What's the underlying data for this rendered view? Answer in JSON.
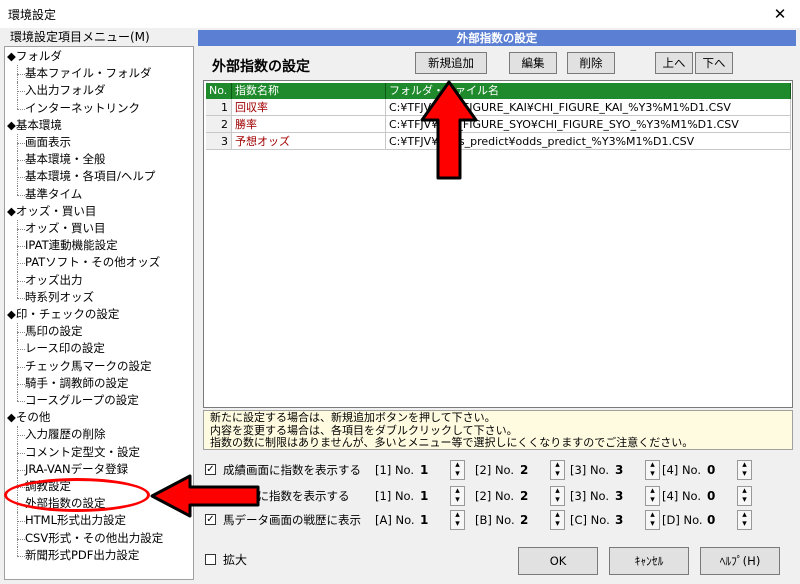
{
  "window": {
    "title": "環境設定",
    "close_glyph": "✕"
  },
  "menu": {
    "header": "環境設定項目メニュー(M)",
    "items": [
      {
        "type": "cat",
        "label": "◆フォルダ"
      },
      {
        "type": "sub",
        "label": "基本ファイル・フォルダ"
      },
      {
        "type": "sub",
        "label": "入出力フォルダ"
      },
      {
        "type": "sub",
        "label": "インターネットリンク"
      },
      {
        "type": "cat",
        "label": "◆基本環境"
      },
      {
        "type": "sub",
        "label": "画面表示"
      },
      {
        "type": "sub",
        "label": "基本環境・全般"
      },
      {
        "type": "sub",
        "label": "基本環境・各項目/ヘルプ"
      },
      {
        "type": "sub",
        "label": "基準タイム"
      },
      {
        "type": "cat",
        "label": "◆オッズ・買い目"
      },
      {
        "type": "sub",
        "label": "オッズ・買い目"
      },
      {
        "type": "sub",
        "label": "IPAT連動機能設定"
      },
      {
        "type": "sub",
        "label": "PATソフト・その他オッズ"
      },
      {
        "type": "sub",
        "label": "オッズ出力"
      },
      {
        "type": "sub",
        "label": "時系列オッズ"
      },
      {
        "type": "cat",
        "label": "◆印・チェックの設定"
      },
      {
        "type": "sub",
        "label": "馬印の設定"
      },
      {
        "type": "sub",
        "label": "レース印の設定"
      },
      {
        "type": "sub",
        "label": "チェック馬マークの設定"
      },
      {
        "type": "sub",
        "label": "騎手・調教師の設定"
      },
      {
        "type": "sub",
        "label": "コースグループの設定"
      },
      {
        "type": "cat",
        "label": "◆その他"
      },
      {
        "type": "sub",
        "label": "入力履歴の削除"
      },
      {
        "type": "sub",
        "label": "コメント定型文・設定"
      },
      {
        "type": "sub",
        "label": "JRA-VANデータ登録"
      },
      {
        "type": "sub",
        "label": "調教設定"
      },
      {
        "type": "sub",
        "label": "外部指数の設定"
      },
      {
        "type": "sub",
        "label": "HTML形式出力設定"
      },
      {
        "type": "sub",
        "label": "CSV形式・その他出力設定"
      },
      {
        "type": "sub",
        "label": "新聞形式PDF出力設定"
      }
    ]
  },
  "panel": {
    "header": "外部指数の設定",
    "title": "外部指数の設定",
    "buttons": {
      "add": "新規追加",
      "edit": "編集",
      "delete": "削除",
      "up": "上へ",
      "down": "下へ"
    },
    "grid": {
      "headers": [
        "No.",
        "指数名称",
        "フォルダ・ファイル名"
      ],
      "rows": [
        {
          "no": "1",
          "name": "回収率",
          "path": "C:¥TFJV¥CHI_FIGURE_KAI¥CHI_FIGURE_KAI_%Y3%M1%D1.CSV"
        },
        {
          "no": "2",
          "name": "勝率",
          "path": "C:¥TFJV¥CHI_FIGURE_SYO¥CHI_FIGURE_SYO_%Y3%M1%D1.CSV"
        },
        {
          "no": "3",
          "name": "予想オッズ",
          "path": "C:¥TFJV¥odds_predict¥odds_predict_%Y3%M1%D1.CSV"
        }
      ]
    },
    "info_lines": [
      "新たに設定する場合は、新規追加ボタンを押して下さい。",
      "内容を変更する場合は、各項目をダブルクリックして下さい。",
      "指数の数に制限はありませんが、多いとメニュー等で選択しにくくなりますのでご注意ください。"
    ],
    "options": [
      {
        "checked": true,
        "label": "成績画面に指数を表示する",
        "slots": [
          [
            "[1] No.",
            "1"
          ],
          [
            "[2] No.",
            "2"
          ],
          [
            "[3] No.",
            "3"
          ],
          [
            "[4] No.",
            "0"
          ]
        ]
      },
      {
        "checked": true,
        "label": "出馬表に指数を表示する",
        "slots": [
          [
            "[1] No.",
            "1"
          ],
          [
            "[2] No.",
            "2"
          ],
          [
            "[3] No.",
            "3"
          ],
          [
            "[4] No.",
            "0"
          ]
        ]
      },
      {
        "checked": true,
        "label": "馬データ画面の戦歴に表示",
        "slots": [
          [
            "[A] No.",
            "1"
          ],
          [
            "[B] No.",
            "2"
          ],
          [
            "[C] No.",
            "3"
          ],
          [
            "[D] No.",
            "0"
          ]
        ]
      }
    ]
  },
  "footer": {
    "zoom_label": "拡大",
    "ok": "OK",
    "cancel": "ｷｬﾝｾﾙ",
    "help": "ﾍﾙﾌﾟ(H)"
  },
  "annotations": {
    "arrow_color": "#ff0000",
    "arrow_border": "#000000"
  }
}
